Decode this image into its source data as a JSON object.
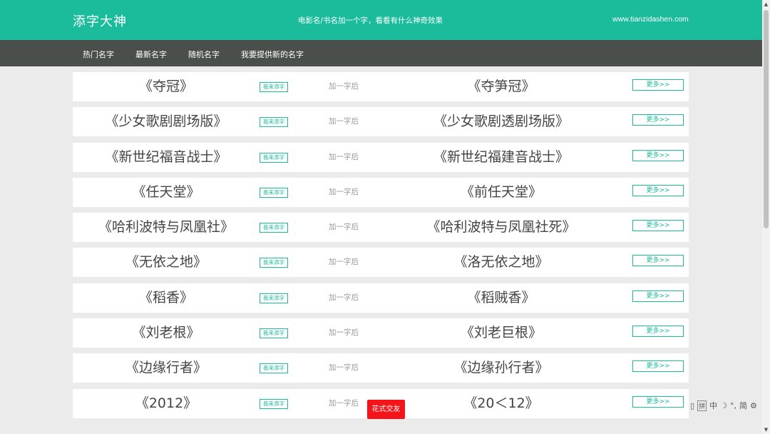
{
  "header": {
    "logo": "添字大神",
    "tagline": "电影名/书名加一个字，看看有什么神奇效果",
    "site_url": "www.tianzidashen.com"
  },
  "nav": [
    {
      "label": "热门名字"
    },
    {
      "label": "最新名字"
    },
    {
      "label": "随机名字"
    },
    {
      "label": "我要提供新的名字"
    }
  ],
  "rows": [
    {
      "original": "《夺冠》",
      "add_label": "我来添字",
      "after_label": "加一字后",
      "result": "《夺笋冠》",
      "more_label": "更多>>"
    },
    {
      "original": "《少女歌剧剧场版》",
      "add_label": "我来添字",
      "after_label": "加一字后",
      "result": "《少女歌剧透剧场版》",
      "more_label": "更多>>"
    },
    {
      "original": "《新世纪福音战士》",
      "add_label": "我来添字",
      "after_label": "加一字后",
      "result": "《新世纪福建音战士》",
      "more_label": "更多>>"
    },
    {
      "original": "《任天堂》",
      "add_label": "我来添字",
      "after_label": "加一字后",
      "result": "《前任天堂》",
      "more_label": "更多>>"
    },
    {
      "original": "《哈利波特与凤凰社》",
      "add_label": "我来添字",
      "after_label": "加一字后",
      "result": "《哈利波特与凤凰社死》",
      "more_label": "更多>>"
    },
    {
      "original": "《无依之地》",
      "add_label": "我来添字",
      "after_label": "加一字后",
      "result": "《洛无依之地》",
      "more_label": "更多>>"
    },
    {
      "original": "《稻香》",
      "add_label": "我来添字",
      "after_label": "加一字后",
      "result": "《稻贼香》",
      "more_label": "更多>>"
    },
    {
      "original": "《刘老根》",
      "add_label": "我来添字",
      "after_label": "加一字后",
      "result": "《刘老巨根》",
      "more_label": "更多>>"
    },
    {
      "original": "《边缘行者》",
      "add_label": "我来添字",
      "after_label": "加一字后",
      "result": "《边缘孙行者》",
      "more_label": "更多>>"
    },
    {
      "original": "《2012》",
      "add_label": "我来添字",
      "after_label": "加一字后",
      "result": "《20＜12》",
      "more_label": "更多>>"
    }
  ],
  "float_button": "花式交友",
  "ime_bar": [
    "拼",
    "中",
    "简"
  ],
  "colors": {
    "accent": "#1bbc9b",
    "nav_bg": "#4a4f4c",
    "float_bg": "#f5141a"
  }
}
